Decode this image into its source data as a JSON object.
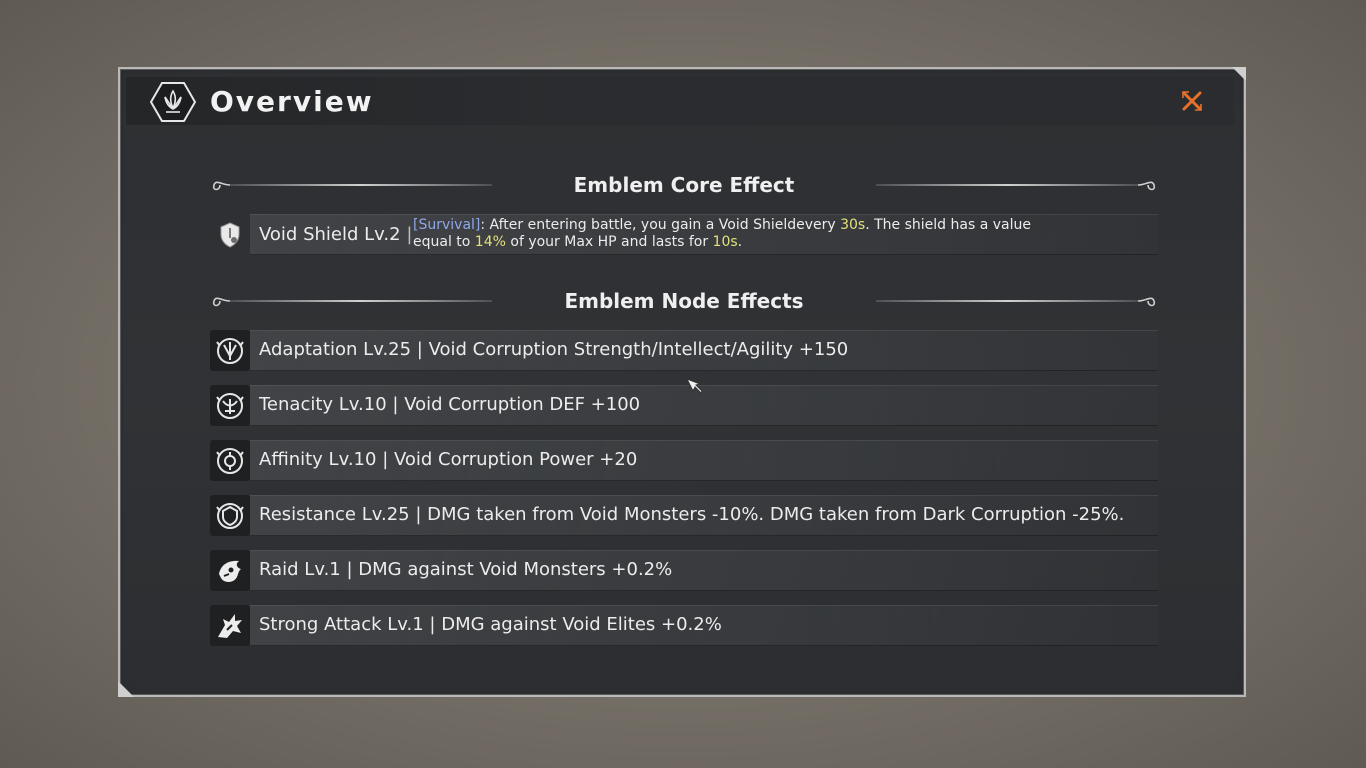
{
  "window": {
    "title": "Overview"
  },
  "core_section": {
    "heading": "Emblem Core Effect",
    "item": {
      "icon": "shield-icon",
      "name": "Void Shield Lv.2",
      "separator": "|",
      "tag": "[Survival]",
      "desc_a": ": After entering battle, you gain a Void Shieldevery ",
      "num_a": "30s",
      "desc_b": ". The shield has a value",
      "desc_c": "equal to ",
      "num_b": "14%",
      "desc_d": " of your Max HP and lasts for ",
      "num_c": "10s",
      "desc_e": "."
    }
  },
  "node_section": {
    "heading": "Emblem Node Effects",
    "items": [
      {
        "icon": "adaptation-emblem-icon",
        "text": "Adaptation Lv.25 | Void Corruption Strength/Intellect/Agility +150"
      },
      {
        "icon": "tenacity-emblem-icon",
        "text": "Tenacity Lv.10 | Void Corruption DEF +100"
      },
      {
        "icon": "affinity-emblem-icon",
        "text": "Affinity Lv.10 | Void Corruption Power +20"
      },
      {
        "icon": "resistance-emblem-icon",
        "text": "Resistance Lv.25 | DMG taken from Void Monsters -10%. DMG taken from Dark Corruption -25%."
      },
      {
        "icon": "raid-emblem-icon",
        "text": "Raid Lv.1 | DMG against Void Monsters +0.2%"
      },
      {
        "icon": "strong-attack-emblem-icon",
        "text": "Strong Attack Lv.1 | DMG against Void Elites +0.2%"
      }
    ]
  },
  "colors": {
    "tag": "#8fa8e8",
    "number_highlight": "#e3e07a",
    "close_icon": "#e8712a"
  }
}
